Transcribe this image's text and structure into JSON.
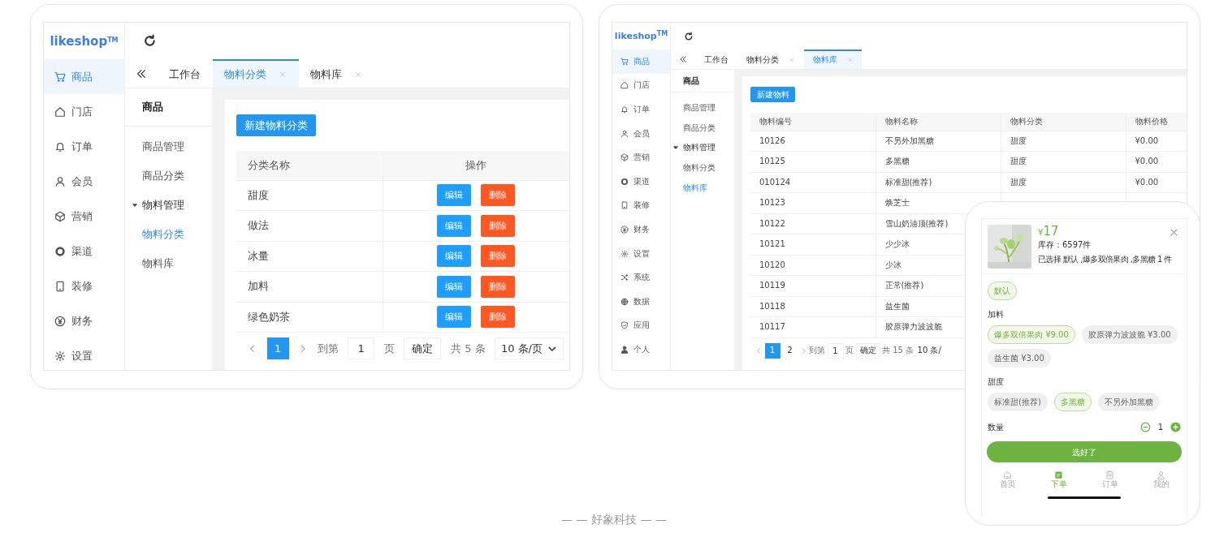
{
  "left_screen": {
    "logo": "likeshop$^{TM}$",
    "sidebar": [
      {
        "label": "商品",
        "selected": true
      },
      {
        "label": "门店",
        "selected": false
      },
      {
        "label": "订单",
        "selected": false
      },
      {
        "label": "会员",
        "selected": false
      },
      {
        "label": "营销",
        "selected": false
      },
      {
        "label": "渠道",
        "selected": false
      },
      {
        "label": "装修",
        "selected": false
      },
      {
        "label": "财务",
        "selected": false
      },
      {
        "label": "设置",
        "selected": false
      }
    ],
    "tabs": [
      {
        "label": "工作台",
        "selected": false,
        "closable": false
      },
      {
        "label": "物料分类",
        "selected": true,
        "closable": true
      },
      {
        "label": "物料库",
        "selected": false,
        "closable": true
      }
    ],
    "subnav": {
      "title": "商品",
      "items": [
        {
          "label": "商品管理",
          "selected": false
        },
        {
          "label": "商品分类",
          "selected": false
        },
        {
          "label": "物料管理",
          "expanded": true,
          "children": [
            {
              "label": "物料分类",
              "selected": true
            },
            {
              "label": "物料库",
              "selected": false
            }
          ]
        }
      ]
    },
    "button": "新建物料分类",
    "table": {
      "columns": [
        "分类名称",
        "操作"
      ],
      "rows": [
        {
          "cells": [
            "甜度"
          ],
          "actions": [
            "编辑",
            "删除"
          ]
        },
        {
          "cells": [
            "做法"
          ],
          "actions": [
            "编辑",
            "删除"
          ]
        },
        {
          "cells": [
            "冰量"
          ],
          "actions": [
            "编辑",
            "删除"
          ]
        },
        {
          "cells": [
            "加料"
          ],
          "actions": [
            "编辑",
            "删除"
          ]
        },
        {
          "cells": [
            "绿色奶茶"
          ],
          "actions": [
            "编辑",
            "删除"
          ]
        }
      ]
    },
    "pagination": {
      "pages": [
        {
          "label": "1",
          "selected": true
        }
      ],
      "goto_label": "到第",
      "goto_value": "1",
      "page_unit": "页",
      "confirm": "确定",
      "total": "共 5 条",
      "page_size": "10 条/页",
      "dropdown": true
    }
  },
  "right_screen": {
    "logo": "likeshop$^{TM}$",
    "sidebar": [
      {
        "label": "商品",
        "selected": true
      },
      {
        "label": "门店",
        "selected": false
      },
      {
        "label": "订单",
        "selected": false
      },
      {
        "label": "会员",
        "selected": false
      },
      {
        "label": "营销",
        "selected": false
      },
      {
        "label": "渠道",
        "selected": false
      },
      {
        "label": "装修",
        "selected": false
      },
      {
        "label": "财务",
        "selected": false
      },
      {
        "label": "设置",
        "selected": false
      },
      {
        "label": "系统",
        "selected": false
      },
      {
        "label": "数据",
        "selected": false
      },
      {
        "label": "应用",
        "selected": false
      },
      {
        "label": "个人",
        "selected": false
      }
    ],
    "tabs": [
      {
        "label": "工作台",
        "selected": false,
        "closable": false
      },
      {
        "label": "物料分类",
        "selected": false,
        "closable": true
      },
      {
        "label": "物料库",
        "selected": true,
        "closable": true
      }
    ],
    "subnav": {
      "title": "商品",
      "items": [
        {
          "label": "商品管理",
          "selected": false
        },
        {
          "label": "商品分类",
          "selected": false
        },
        {
          "label": "物料管理",
          "expanded": true,
          "children": [
            {
              "label": "物料分类",
              "selected": false
            },
            {
              "label": "物料库",
              "selected": true
            }
          ]
        }
      ]
    },
    "button": "新建物料",
    "table": {
      "columns": [
        "物料编号",
        "物料名称",
        "物料分类",
        "物料价格"
      ],
      "rows": [
        {
          "cells": [
            "10126",
            "不另外加黑糖",
            "甜度",
            "¥0.00"
          ]
        },
        {
          "cells": [
            "10125",
            "多黑糖",
            "甜度",
            "¥0.00"
          ]
        },
        {
          "cells": [
            "010124",
            "标准甜(推荐)",
            "甜度",
            "¥0.00"
          ]
        },
        {
          "cells": [
            "10123",
            "焕芝士"
          ]
        },
        {
          "cells": [
            "10122",
            "雪山奶油顶(推荐)"
          ]
        },
        {
          "cells": [
            "10121",
            "少少冰"
          ]
        },
        {
          "cells": [
            "10120",
            "少冰"
          ]
        },
        {
          "cells": [
            "10119",
            "正常(推荐)"
          ]
        },
        {
          "cells": [
            "10118",
            "益生菌"
          ]
        },
        {
          "cells": [
            "10117",
            "胶原弹力波波脆"
          ]
        }
      ]
    },
    "pagination": {
      "pages": [
        {
          "label": "1",
          "selected": true
        },
        {
          "label": "2",
          "selected": false
        }
      ],
      "goto_label": "到第",
      "goto_value": "1",
      "page_unit": "页",
      "confirm": "确定",
      "total": "共 15 条",
      "page_size": "10 条/",
      "dropdown": false
    }
  },
  "phone": {
    "price_currency": "¥",
    "price": "17",
    "stock": "库存：6597件",
    "summary": "已选择 默认 ,爆多双倍果肉 ,多黑糖 1 件",
    "groups": [
      {
        "options": [
          {
            "label": "默认",
            "selected": true
          }
        ]
      },
      {
        "title": "加料",
        "options": [
          {
            "label": "爆多双倍果肉 ¥9.00",
            "selected": true
          },
          {
            "label": "胶原弹力波波脆 ¥3.00",
            "selected": false
          },
          {
            "label": "益生菌 ¥3.00",
            "selected": false
          }
        ]
      },
      {
        "title": "甜度",
        "options": [
          {
            "label": "标准甜(推荐)",
            "selected": false
          },
          {
            "label": "多黑糖",
            "selected": true
          },
          {
            "label": "不另外加黑糖",
            "selected": false
          }
        ]
      }
    ],
    "quantity": {
      "label": "数量",
      "value": "1"
    },
    "confirm": "选好了",
    "nav": [
      {
        "label": "首页",
        "selected": false
      },
      {
        "label": "下单",
        "selected": true
      },
      {
        "label": "订单",
        "selected": false
      },
      {
        "label": "我的",
        "selected": false
      }
    ]
  },
  "footer": "— — 好象科技 — —"
}
